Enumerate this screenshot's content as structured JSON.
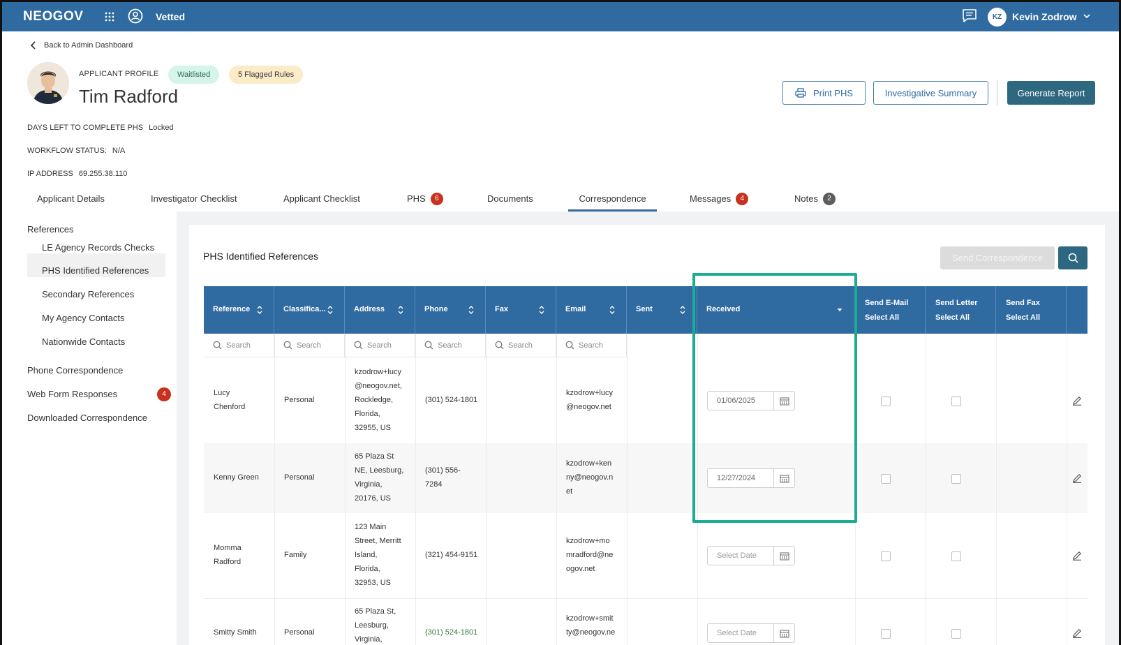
{
  "topbar": {
    "logo": "NEOGOV",
    "app_name": "Vetted",
    "user_initials": "KZ",
    "user_name": "Kevin Zodrow"
  },
  "header": {
    "back_label": "Back to Admin Dashboard",
    "profile_label": "APPLICANT PROFILE",
    "badge_status": "Waitlisted",
    "badge_flags": "5 Flagged Rules",
    "applicant_name": "Tim Radford",
    "print_label": "Print PHS",
    "investigative_label": "Investigative Summary",
    "report_label": "Generate Report"
  },
  "meta": [
    {
      "label": "DAYS LEFT TO COMPLETE PHS",
      "value": "Locked"
    },
    {
      "label": "WORKFLOW STATUS:",
      "value": "N/A"
    },
    {
      "label": "IP ADDRESS",
      "value": "69.255.38.110"
    }
  ],
  "tabs": [
    {
      "label": "Applicant Details"
    },
    {
      "label": "Investigator Checklist"
    },
    {
      "label": "Applicant Checklist"
    },
    {
      "label": "PHS",
      "count": "6"
    },
    {
      "label": "Documents"
    },
    {
      "label": "Correspondence",
      "active": true
    },
    {
      "label": "Messages",
      "count": "4"
    },
    {
      "label": "Notes",
      "count": "2"
    }
  ],
  "sidebar": {
    "section": "References",
    "items": [
      "LE Agency Records Checks",
      "PHS Identified References",
      "Secondary References",
      "My Agency Contacts",
      "Nationwide Contacts"
    ],
    "phone": "Phone Correspondence",
    "webform": "Web Form Responses",
    "webform_count": "4",
    "downloaded": "Downloaded Correspondence"
  },
  "panel": {
    "title": "PHS Identified References",
    "send_label": "Send Correspondence"
  },
  "table": {
    "headers": [
      "Reference",
      "Classifica...",
      "Address",
      "Phone",
      "Fax",
      "Email",
      "Sent",
      "Received"
    ],
    "header_email": [
      "Send E-Mail",
      "Select All"
    ],
    "header_letter": [
      "Send Letter",
      "Select All"
    ],
    "header_fax": [
      "Send Fax",
      "Select All"
    ],
    "search_placeholder": "Search",
    "rows": [
      {
        "reference": [
          "Lucy",
          "Chenford"
        ],
        "classification": "Personal",
        "address": [
          "kzodrow+lucy",
          "@neogov.net,",
          "Rockledge,",
          "Florida,",
          "32955, US"
        ],
        "phone": [
          "(301) 524-1801"
        ],
        "email": [
          "kzodrow+lucy",
          "@neogov.net"
        ],
        "received": "01/06/2025"
      },
      {
        "reference": [
          "Kenny Green"
        ],
        "classification": "Personal",
        "address": [
          "65 Plaza St",
          "NE, Leesburg,",
          "Virginia,",
          "20176, US"
        ],
        "phone": [
          "(301) 556-",
          "7284"
        ],
        "email": [
          "kzodrow+ken",
          "ny@neogov.n",
          "et"
        ],
        "received": "12/27/2024"
      },
      {
        "reference": [
          "Momma",
          "Radford"
        ],
        "classification": "Family",
        "address": [
          "123 Main",
          "Street, Merritt",
          "Island,",
          "Florida,",
          "32953, US"
        ],
        "phone": [
          "(321) 454-9151"
        ],
        "email": [
          "kzodrow+mo",
          "mradford@ne",
          "ogov.net"
        ],
        "received": "Select Date"
      },
      {
        "reference": [
          "Smitty Smith"
        ],
        "classification": "Personal",
        "address": [
          "65 Plaza St,",
          "Leesburg,",
          "Virginia,"
        ],
        "phone": [
          "(301) 524-1801"
        ],
        "email": [
          "kzodrow+smit",
          "ty@neogov.ne"
        ],
        "received": "Select Date"
      }
    ]
  },
  "colors": {
    "primary": "#2f6aa0",
    "dark_teal": "#2e6780",
    "highlight": "#1dab92",
    "badge_red": "#c8311f"
  }
}
